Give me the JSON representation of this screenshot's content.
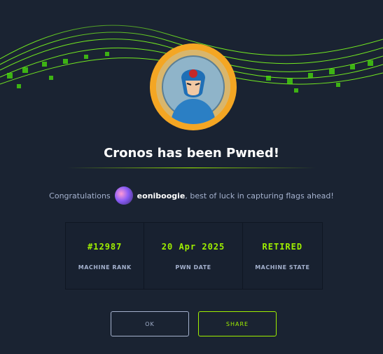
{
  "title": "Cronos has been Pwned!",
  "congrats": {
    "prefix": "Congratulations",
    "username": "eoniboogie",
    "suffix": ", best of luck in capturing flags ahead!"
  },
  "stats": [
    {
      "value": "#12987",
      "label": "MACHINE RANK"
    },
    {
      "value": "20 Apr 2025",
      "label": "PWN DATE"
    },
    {
      "value": "RETIRED",
      "label": "MACHINE STATE"
    }
  ],
  "buttons": {
    "ok": "OK",
    "share": "SHARE"
  },
  "colors": {
    "background": "#1a2332",
    "accent": "#9fef00",
    "avatar_ring": "#f4a623",
    "muted_text": "#a4b1cd"
  }
}
